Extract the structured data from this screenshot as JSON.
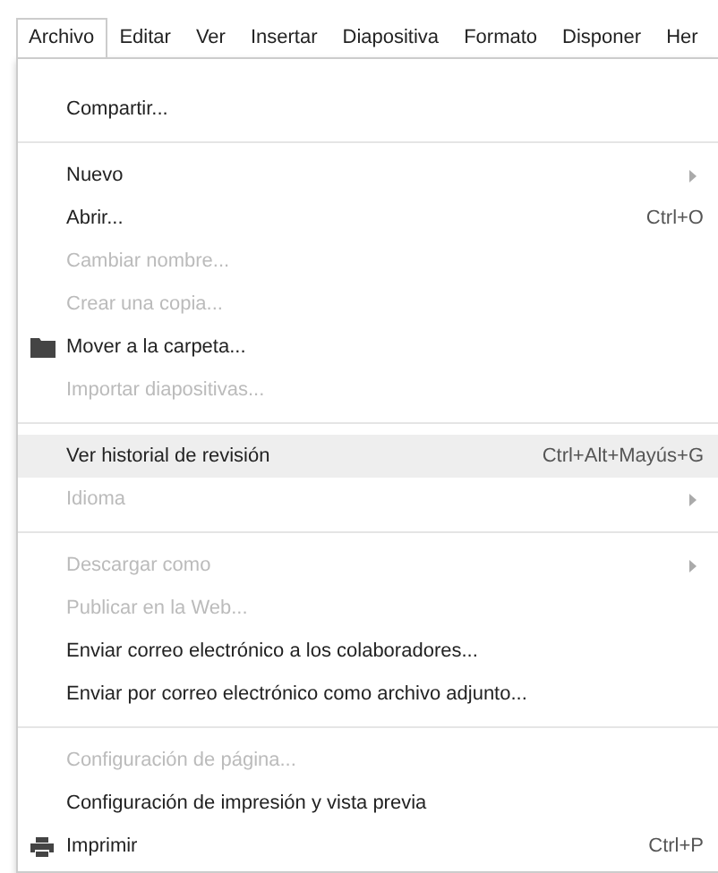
{
  "menubar": [
    {
      "label": "Archivo",
      "selected": true
    },
    {
      "label": "Editar",
      "selected": false
    },
    {
      "label": "Ver",
      "selected": false
    },
    {
      "label": "Insertar",
      "selected": false
    },
    {
      "label": "Diapositiva",
      "selected": false
    },
    {
      "label": "Formato",
      "selected": false
    },
    {
      "label": "Disponer",
      "selected": false
    },
    {
      "label": "Her",
      "selected": false
    }
  ],
  "menu": {
    "sections": [
      {
        "items": [
          {
            "kind": "plain",
            "label": "Compartir...",
            "disabled": false,
            "selected": false,
            "submenu": false
          }
        ]
      },
      {
        "items": [
          {
            "kind": "plain",
            "label": "Nuevo",
            "disabled": false,
            "selected": false,
            "submenu": true
          },
          {
            "kind": "plain",
            "label": "Abrir...",
            "shortcut": "Ctrl+O",
            "disabled": false,
            "selected": false,
            "submenu": false
          },
          {
            "kind": "plain",
            "label": "Cambiar nombre...",
            "disabled": true,
            "selected": false,
            "submenu": false
          },
          {
            "kind": "plain",
            "label": "Crear una copia...",
            "disabled": true,
            "selected": false,
            "submenu": false
          },
          {
            "kind": "folder",
            "label": "Mover a la carpeta...",
            "disabled": false,
            "selected": false,
            "submenu": false
          },
          {
            "kind": "plain",
            "label": "Importar diapositivas...",
            "disabled": true,
            "selected": false,
            "submenu": false
          }
        ]
      },
      {
        "items": [
          {
            "kind": "plain",
            "label": "Ver historial de revisión",
            "shortcut": "Ctrl+Alt+Mayús+G",
            "disabled": false,
            "selected": true,
            "submenu": false
          },
          {
            "kind": "plain",
            "label": "Idioma",
            "disabled": true,
            "selected": false,
            "submenu": true
          }
        ]
      },
      {
        "items": [
          {
            "kind": "plain",
            "label": "Descargar como",
            "disabled": true,
            "selected": false,
            "submenu": true
          },
          {
            "kind": "plain",
            "label": "Publicar en la Web...",
            "disabled": true,
            "selected": false,
            "submenu": false
          },
          {
            "kind": "plain",
            "label": "Enviar correo electrónico a los colaboradores...",
            "disabled": false,
            "selected": false,
            "submenu": false
          },
          {
            "kind": "plain",
            "label": "Enviar por correo electrónico como archivo adjunto...",
            "disabled": false,
            "selected": false,
            "submenu": false
          }
        ]
      },
      {
        "items": [
          {
            "kind": "plain",
            "label": "Configuración de página...",
            "disabled": true,
            "selected": false,
            "submenu": false
          },
          {
            "kind": "plain",
            "label": "Configuración de impresión y vista previa",
            "disabled": false,
            "selected": false,
            "submenu": false
          },
          {
            "kind": "printer",
            "label": "Imprimir",
            "shortcut": "Ctrl+P",
            "disabled": false,
            "selected": false,
            "submenu": false
          }
        ]
      }
    ]
  }
}
